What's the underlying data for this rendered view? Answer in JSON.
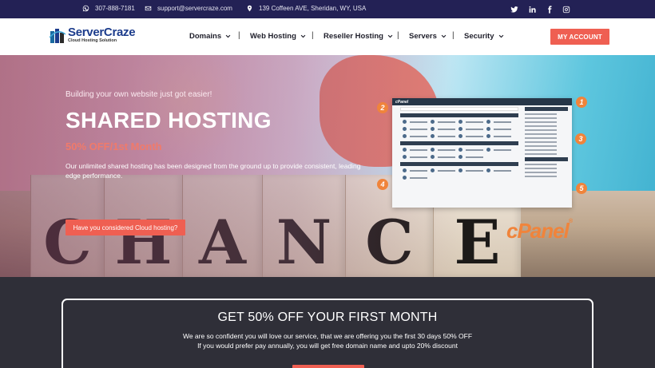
{
  "topbar": {
    "phone": "307-888-7181",
    "email": "support@servercraze.com",
    "address": "139 Coffeen AVE, Sheridan, WY, USA",
    "social_icons": [
      "twitter-icon",
      "linkedin-icon",
      "facebook-icon",
      "instagram-icon"
    ]
  },
  "header": {
    "logo_name": "ServerCraze",
    "logo_tagline": "Cloud Hosting Solution",
    "nav": [
      "Domains",
      "Web Hosting",
      "Reseller Hosting",
      "Servers",
      "Security"
    ],
    "nav_separator": "|",
    "account_button": "MY ACCOUNT"
  },
  "hero": {
    "subtitle": "Building your own website just got easier!",
    "title": "SHARED HOSTING",
    "offer": "50% OFF/1st Month",
    "description": "Our unlimited shared hosting has been designed from the ground up to provide consistent, leading edge performance.",
    "button": "Have you considered Cloud hosting?",
    "block_letters": [
      "C",
      "H",
      "A",
      "N",
      "C",
      "E"
    ],
    "cpanel_badges": [
      "1",
      "2",
      "3",
      "4",
      "5"
    ],
    "cpanel_brand": "cPanel",
    "cpanel_brand_mark": "®"
  },
  "offer_section": {
    "title": "GET 50% OFF YOUR FIRST MONTH",
    "line1": "We are so confident you will love our service, that we are offering you the first 30 days 50% OFF",
    "line2": "If you would prefer pay annually, you will get free domain name and upto 20% discount"
  },
  "colors": {
    "topbar_bg": "#232155",
    "accent": "#ef5f52",
    "logo_blue": "#1c3c8c",
    "cpanel_orange": "#f0843b",
    "section_bg": "#2f2f38"
  }
}
